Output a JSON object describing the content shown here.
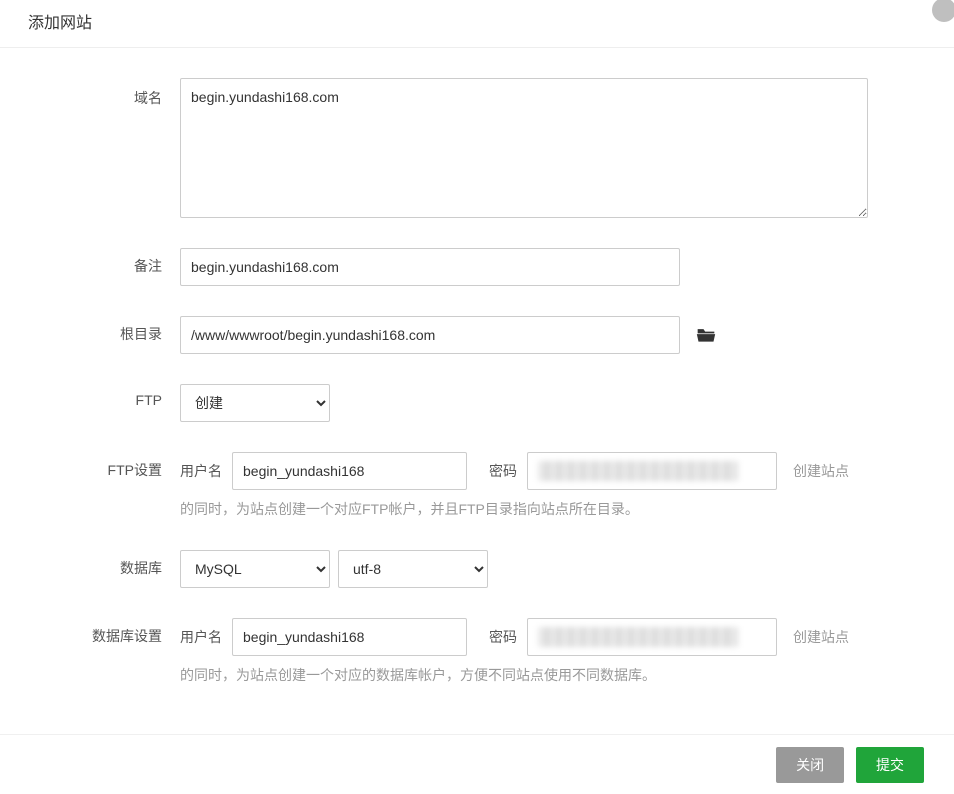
{
  "header": {
    "title": "添加网站"
  },
  "form": {
    "domain": {
      "label": "域名",
      "value": "begin.yundashi168.com"
    },
    "note": {
      "label": "备注",
      "value": "begin.yundashi168.com"
    },
    "root": {
      "label": "根目录",
      "value": "/www/wwwroot/begin.yundashi168.com"
    },
    "ftp": {
      "label": "FTP",
      "selected": "创建",
      "options": [
        "创建"
      ]
    },
    "ftp_settings": {
      "label": "FTP设置",
      "user_label": "用户名",
      "user_value": "begin_yundashi168",
      "pw_label": "密码",
      "right_text": "创建站点",
      "hint": "的同时，为站点创建一个对应FTP帐户，并且FTP目录指向站点所在目录。"
    },
    "db": {
      "label": "数据库",
      "type_selected": "MySQL",
      "type_options": [
        "MySQL"
      ],
      "charset_selected": "utf-8",
      "charset_options": [
        "utf-8"
      ]
    },
    "db_settings": {
      "label": "数据库设置",
      "user_label": "用户名",
      "user_value": "begin_yundashi168",
      "pw_label": "密码",
      "right_text": "创建站点",
      "hint": "的同时，为站点创建一个对应的数据库帐户，方便不同站点使用不同数据库。"
    }
  },
  "footer": {
    "cancel": "关闭",
    "submit": "提交"
  }
}
